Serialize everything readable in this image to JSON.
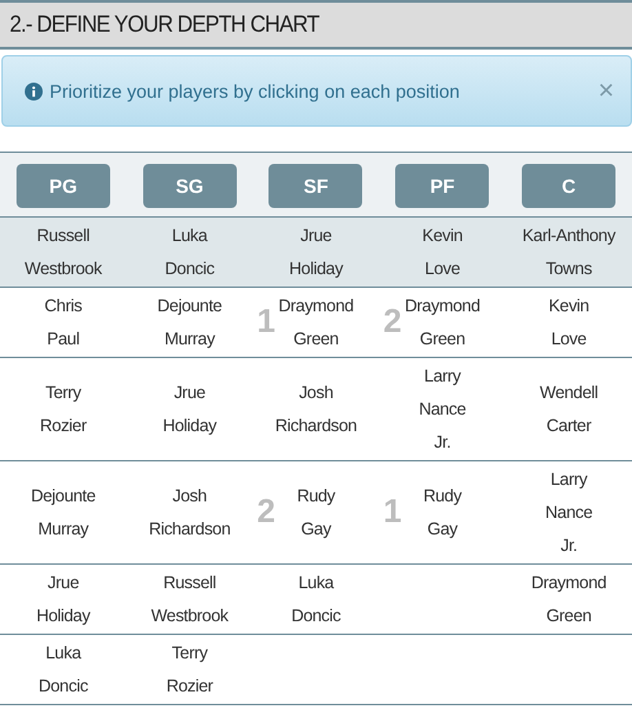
{
  "section_title": "2.- DEFINE YOUR DEPTH CHART",
  "alert": {
    "message": "Prioritize your players by clicking on each position",
    "close": "×"
  },
  "positions": [
    {
      "label": "PG"
    },
    {
      "label": "SG"
    },
    {
      "label": "SF"
    },
    {
      "label": "PF"
    },
    {
      "label": "C"
    }
  ],
  "rows": [
    {
      "highlighted": true,
      "cells": [
        {
          "name": "Russell Westbrook"
        },
        {
          "name": "Luka Doncic"
        },
        {
          "name": "Jrue Holiday"
        },
        {
          "name": "Kevin Love"
        },
        {
          "name": "Karl-Anthony Towns"
        }
      ]
    },
    {
      "highlighted": false,
      "cells": [
        {
          "name": "Chris Paul"
        },
        {
          "name": "Dejounte Murray"
        },
        {
          "name": "Draymond Green",
          "badge": "1"
        },
        {
          "name": "Draymond Green",
          "badge": "2"
        },
        {
          "name": "Kevin Love"
        }
      ]
    },
    {
      "highlighted": false,
      "cells": [
        {
          "name": "Terry Rozier"
        },
        {
          "name": "Jrue Holiday"
        },
        {
          "name": "Josh Richardson"
        },
        {
          "name": "Larry Nance Jr."
        },
        {
          "name": "Wendell Carter"
        }
      ]
    },
    {
      "highlighted": false,
      "cells": [
        {
          "name": "Dejounte Murray"
        },
        {
          "name": "Josh Richardson"
        },
        {
          "name": "Rudy Gay",
          "badge": "2"
        },
        {
          "name": "Rudy Gay",
          "badge": "1"
        },
        {
          "name": "Larry Nance Jr."
        }
      ]
    },
    {
      "highlighted": false,
      "cells": [
        {
          "name": "Jrue Holiday"
        },
        {
          "name": "Russell Westbrook"
        },
        {
          "name": "Luka Doncic"
        },
        null,
        {
          "name": "Draymond Green"
        }
      ]
    },
    {
      "highlighted": false,
      "cells": [
        {
          "name": "Luka Doncic"
        },
        {
          "name": "Terry Rozier"
        },
        null,
        null,
        null
      ]
    }
  ]
}
